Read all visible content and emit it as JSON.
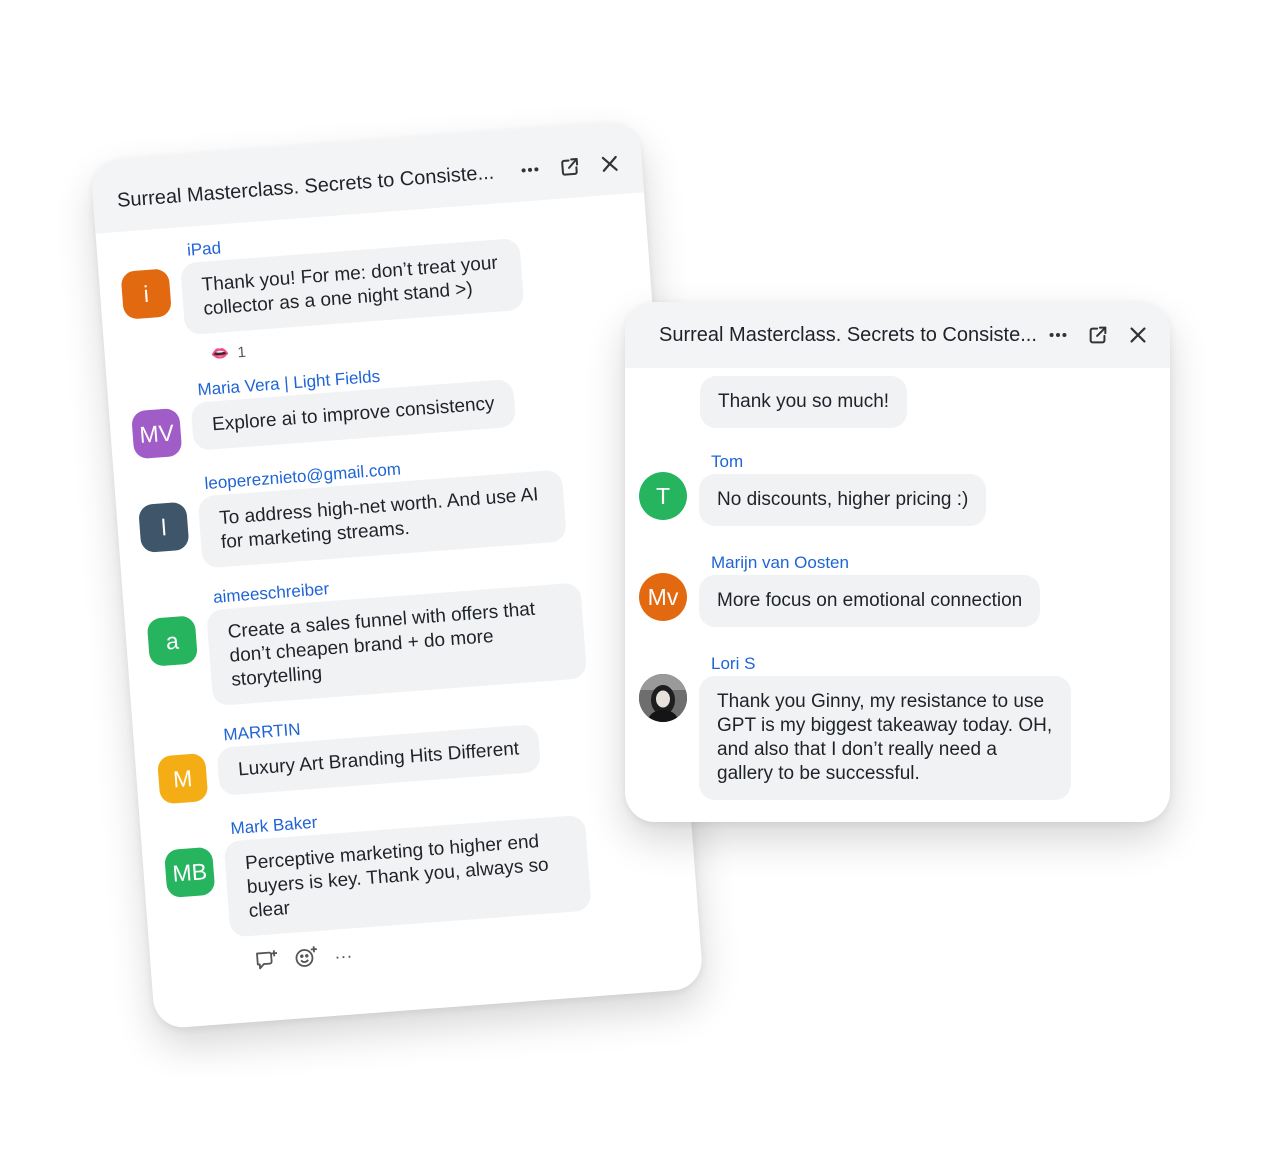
{
  "back_panel": {
    "title": "Surreal Masterclass. Secrets to Consiste...",
    "messages": [
      {
        "sender": "iPad",
        "avatar": "i",
        "avatar_color": "#e2690f",
        "text": "Thank you! For me: don’t treat your collector as a one night stand >)"
      },
      {
        "sender": "Maria Vera | Light Fields",
        "avatar": "MV",
        "avatar_color": "#a05cc7",
        "text": "Explore ai to improve consistency"
      },
      {
        "sender": "leopereznieto@gmail.com",
        "avatar": "l",
        "avatar_color": "#3f556a",
        "text": "To address high-net worth. And use AI for marketing streams."
      },
      {
        "sender": "aimeeschreiber",
        "avatar": "a",
        "avatar_color": "#27b45e",
        "text": "Create a sales funnel with offers that don’t cheapen brand + do more storytelling"
      },
      {
        "sender": "MARRTIN",
        "avatar": "M",
        "avatar_color": "#f4ad14",
        "text": "Luxury Art Branding Hits Different"
      },
      {
        "sender": "Mark Baker",
        "avatar": "MB",
        "avatar_color": "#27b45e",
        "text": "Perceptive marketing to higher end buyers is key. Thank you, always so clear"
      }
    ],
    "reaction": {
      "icon": "lips-emoji",
      "emoji": "👄",
      "count": "1"
    },
    "toolbar": {
      "reply_icon": "reply-icon",
      "emoji_icon": "add-reaction-icon",
      "more": "···"
    }
  },
  "front_panel": {
    "title": "Surreal Masterclass. Secrets to Consiste...",
    "first_message": "Thank you so much!",
    "messages": [
      {
        "sender": "Tom",
        "avatar": "T",
        "avatar_color": "#27b45e",
        "text": "No discounts, higher pricing :)"
      },
      {
        "sender": "Marijn van Oosten",
        "avatar": "Mv",
        "avatar_color": "#e2690f",
        "text": "More focus on emotional connection"
      },
      {
        "sender": "Lori S",
        "avatar": "",
        "avatar_color": "#3b3b3b",
        "text": "Thank you Ginny, my resistance to use GPT is my biggest takeaway today. OH, and also that I don’t really need a gallery to be successful."
      }
    ]
  },
  "header_icons": {
    "more": "more-dots-icon",
    "popout": "popout-icon",
    "close": "close-icon"
  }
}
